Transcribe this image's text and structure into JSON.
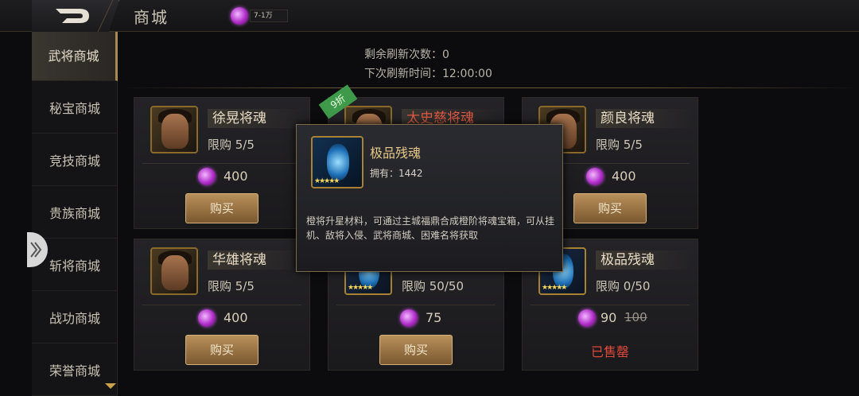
{
  "header": {
    "title": "商城",
    "currency_amount": "7-1万"
  },
  "sidebar": {
    "items": [
      {
        "label": "武将商城",
        "active": true
      },
      {
        "label": "秘宝商城"
      },
      {
        "label": "竞技商城"
      },
      {
        "label": "贵族商城"
      },
      {
        "label": "斩将商城"
      },
      {
        "label": "战功商城"
      },
      {
        "label": "荣誉商城"
      }
    ]
  },
  "refresh": {
    "remaining": "剩余刷新次数：0",
    "next_time": "下次刷新时间：12:00:00"
  },
  "cards": [
    {
      "name": "徐晃将魂",
      "limit": "限购 5/5",
      "price": "400",
      "button": "购买"
    },
    {
      "name": "太史慈将魂",
      "discount": "9折"
    },
    {
      "name": "颜良将魂",
      "limit": "限购 5/5",
      "price": "400",
      "button": "购买"
    },
    {
      "name": "华雄将魂",
      "limit": "限购 5/5",
      "price": "400",
      "button": "购买"
    },
    {
      "limit": "限购 50/50",
      "price": "75",
      "button": "购买"
    },
    {
      "name": "极品残魂",
      "limit": "限购 0/50",
      "price": "90",
      "old_price": "100",
      "status": "已售罄"
    }
  ],
  "tooltip": {
    "name": "极品残魂",
    "owned": "拥有：1442",
    "description": "橙将升星材料，可通过主城福鼎合成橙阶将魂宝箱，可从挂机、敌将入侵、武将商城、困难名将获取"
  },
  "colors": {
    "accent_gold": "#c9a24a",
    "currency_purple": "#b02cc9",
    "sold_out_red": "#e04a3a",
    "discount_green": "#3e9a4a"
  }
}
